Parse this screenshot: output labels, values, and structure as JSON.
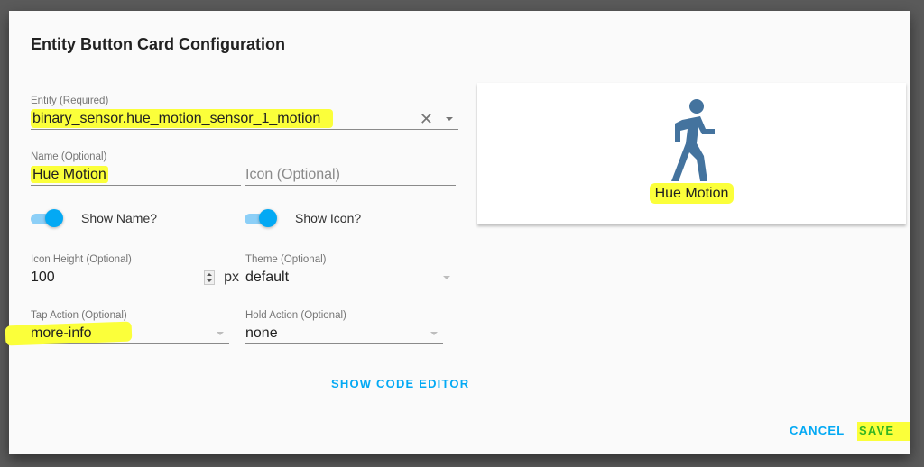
{
  "dialog": {
    "title": "Entity Button Card Configuration"
  },
  "form": {
    "entity": {
      "label": "Entity (Required)",
      "value": "binary_sensor.hue_motion_sensor_1_motion",
      "clear_icon": "close-icon",
      "dropdown_icon": "caret-down-icon"
    },
    "name": {
      "label": "Name (Optional)",
      "value": "Hue Motion"
    },
    "icon": {
      "placeholder": "Icon (Optional)",
      "value": ""
    },
    "show_name": {
      "label": "Show Name?",
      "checked": true
    },
    "show_icon": {
      "label": "Show Icon?",
      "checked": true
    },
    "icon_height": {
      "label": "Icon Height (Optional)",
      "value": "100",
      "suffix": "px"
    },
    "theme": {
      "label": "Theme (Optional)",
      "value": "default"
    },
    "tap_action": {
      "label": "Tap Action (Optional)",
      "value": "more-info"
    },
    "hold_action": {
      "label": "Hold Action (Optional)",
      "value": "none"
    }
  },
  "preview": {
    "icon": "walk-icon",
    "icon_color": "#44739e",
    "name": "Hue Motion"
  },
  "buttons": {
    "show_code_editor": "SHOW CODE EDITOR",
    "cancel": "CANCEL",
    "save": "SAVE"
  },
  "colors": {
    "accent": "#03a9f4",
    "highlight": "#fbff3a",
    "save_text": "#33b522"
  }
}
